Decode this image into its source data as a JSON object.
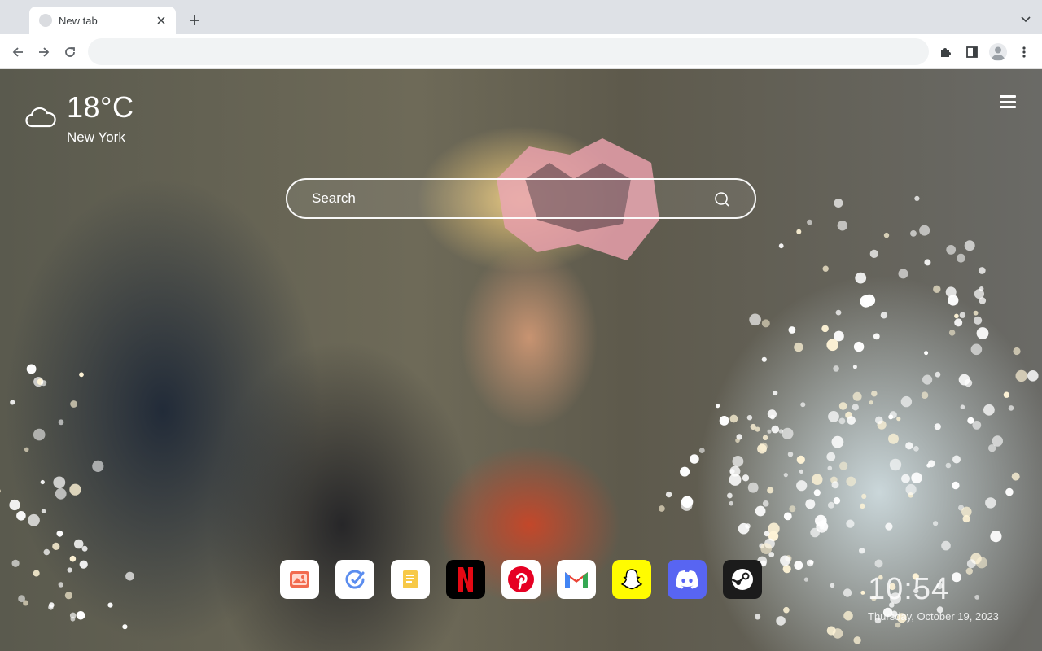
{
  "browser": {
    "tab": {
      "title": "New tab"
    },
    "omnibox": {
      "value": "",
      "placeholder": ""
    }
  },
  "weather": {
    "temperature": "18°C",
    "city": "New York",
    "icon": "cloud-icon"
  },
  "search": {
    "placeholder": "Search"
  },
  "apps": [
    {
      "name": "gallery",
      "icon": "gallery-icon",
      "bg": "#ffffff"
    },
    {
      "name": "tasks",
      "icon": "checkmark-edit-icon",
      "bg": "#ffffff"
    },
    {
      "name": "notes",
      "icon": "notes-icon",
      "bg": "#ffffff"
    },
    {
      "name": "netflix",
      "icon": "netflix-icon",
      "bg": "#000000"
    },
    {
      "name": "pinterest",
      "icon": "pinterest-icon",
      "bg": "#ffffff"
    },
    {
      "name": "gmail",
      "icon": "gmail-icon",
      "bg": "#ffffff"
    },
    {
      "name": "snapchat",
      "icon": "snapchat-icon",
      "bg": "#fffc00"
    },
    {
      "name": "discord",
      "icon": "discord-icon",
      "bg": "#5865f2"
    },
    {
      "name": "steam",
      "icon": "steam-icon",
      "bg": "#1b1b1b"
    }
  ],
  "clock": {
    "time": "10:54",
    "date": "Thursday, October 19, 2023"
  }
}
